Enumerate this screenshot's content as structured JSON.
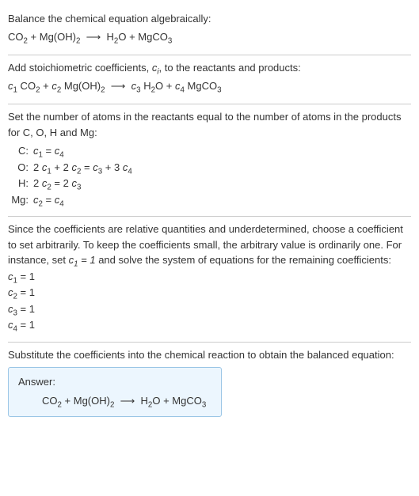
{
  "s1": {
    "title": "Balance the chemical equation algebraically:",
    "eq": "CO_2 + Mg(OH)_2 ⟶ H_2O + MgCO_3"
  },
  "s2": {
    "title_a": "Add stoichiometric coefficients, ",
    "title_b": "c_i",
    "title_c": ", to the reactants and products:",
    "eq_pre": "c_1 CO_2 + c_2 Mg(OH)_2 ⟶ c_3 H_2O + c_4 MgCO_3"
  },
  "s3": {
    "title": "Set the number of atoms in the reactants equal to the number of atoms in the products for C, O, H and Mg:",
    "rows": [
      {
        "label": "C:",
        "val": "c_1 = c_4"
      },
      {
        "label": "O:",
        "val": "2 c_1 + 2 c_2 = c_3 + 3 c_4"
      },
      {
        "label": "H:",
        "val": "2 c_2 = 2 c_3"
      },
      {
        "label": "Mg:",
        "val": "c_2 = c_4"
      }
    ]
  },
  "s4": {
    "title_a": "Since the coefficients are relative quantities and underdetermined, choose a coefficient to set arbitrarily. To keep the coefficients small, the arbitrary value is ordinarily one. For instance, set ",
    "title_b": "c_1 = 1",
    "title_c": " and solve the system of equations for the remaining coefficients:",
    "coeffs": [
      "c_1 = 1",
      "c_2 = 1",
      "c_3 = 1",
      "c_4 = 1"
    ]
  },
  "s5": {
    "title": "Substitute the coefficients into the chemical reaction to obtain the balanced equation:",
    "answer_label": "Answer:",
    "answer_eq": "CO_2 + Mg(OH)_2 ⟶ H_2O + MgCO_3"
  }
}
